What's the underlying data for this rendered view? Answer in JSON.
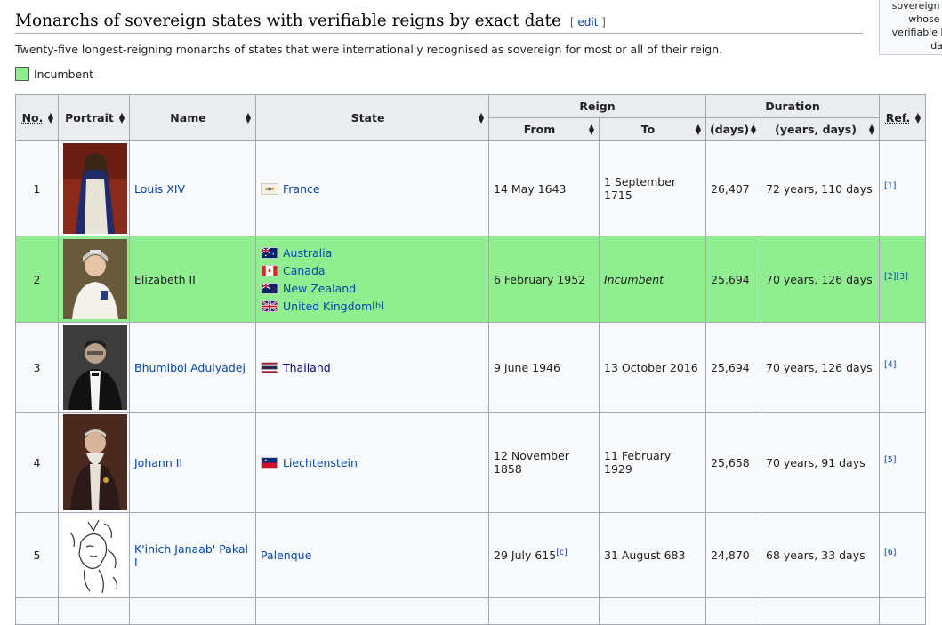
{
  "heading": {
    "title": "Monarchs of sovereign states with verifiable reigns by exact date",
    "edit_open": "[ ",
    "edit_label": "edit",
    "edit_close": " ]"
  },
  "intro": "Twenty-five longest-reigning monarchs of states that were internationally recognised as sovereign for most or all of their reign.",
  "legend": {
    "label": "Incumbent",
    "color": "#90ee90"
  },
  "sidebox": {
    "lines": [
      "sovereign re",
      "whose re",
      "verifiable by",
      "date"
    ]
  },
  "table": {
    "headers": {
      "no": "No.",
      "portrait": "Portrait",
      "name": "Name",
      "state": "State",
      "reign": "Reign",
      "from": "From",
      "to": "To",
      "duration": "Duration",
      "days": "(days)",
      "years_days": "(years, days)",
      "ref": "Ref."
    },
    "rows": [
      {
        "no": "1",
        "name": "Louis XIV",
        "states": [
          {
            "name": "France",
            "flag": "france-royal-flag"
          }
        ],
        "from": "14 May 1643",
        "from_note": "",
        "to": "1 September 1715",
        "to_italic": false,
        "days": "26,407",
        "years_days": "72 years, 110 days",
        "refs": "[1]",
        "incumbent": false,
        "portrait": "louis-xiv-portrait"
      },
      {
        "no": "2",
        "name": "Elizabeth II",
        "states": [
          {
            "name": "Australia",
            "flag": "australia-flag"
          },
          {
            "name": "Canada",
            "flag": "canada-flag"
          },
          {
            "name": "New Zealand",
            "flag": "new-zealand-flag"
          },
          {
            "name": "United Kingdom",
            "flag": "united-kingdom-flag",
            "note": "[b]"
          }
        ],
        "from": "6 February 1952",
        "from_note": "",
        "to": "Incumbent",
        "to_italic": true,
        "days": "25,694",
        "years_days": "70 years, 126 days",
        "refs": "[2][3]",
        "incumbent": true,
        "portrait": "elizabeth-ii-portrait"
      },
      {
        "no": "3",
        "name": "Bhumibol Adulyadej",
        "states": [
          {
            "name": "Thailand",
            "flag": "thailand-flag"
          }
        ],
        "from": "9 June 1946",
        "from_note": "",
        "to": "13 October 2016",
        "to_italic": false,
        "days": "25,694",
        "years_days": "70 years, 126 days",
        "refs": "[4]",
        "incumbent": false,
        "portrait": "bhumibol-portrait"
      },
      {
        "no": "4",
        "name": "Johann II",
        "states": [
          {
            "name": "Liechtenstein",
            "flag": "liechtenstein-flag"
          }
        ],
        "from": "12 November 1858",
        "from_note": "",
        "to": "11 February 1929",
        "to_italic": false,
        "days": "25,658",
        "years_days": "70 years, 91 days",
        "refs": "[5]",
        "incumbent": false,
        "portrait": "johann-ii-portrait"
      },
      {
        "no": "5",
        "name": "K'inich Janaab' Pakal I",
        "states": [
          {
            "name": "Palenque",
            "flag": ""
          }
        ],
        "from": "29 July 615",
        "from_note": "[c]",
        "to": "31 August 683",
        "to_italic": false,
        "days": "24,870",
        "years_days": "68 years, 33 days",
        "refs": "[6]",
        "incumbent": false,
        "portrait": "pakal-drawing"
      }
    ]
  }
}
